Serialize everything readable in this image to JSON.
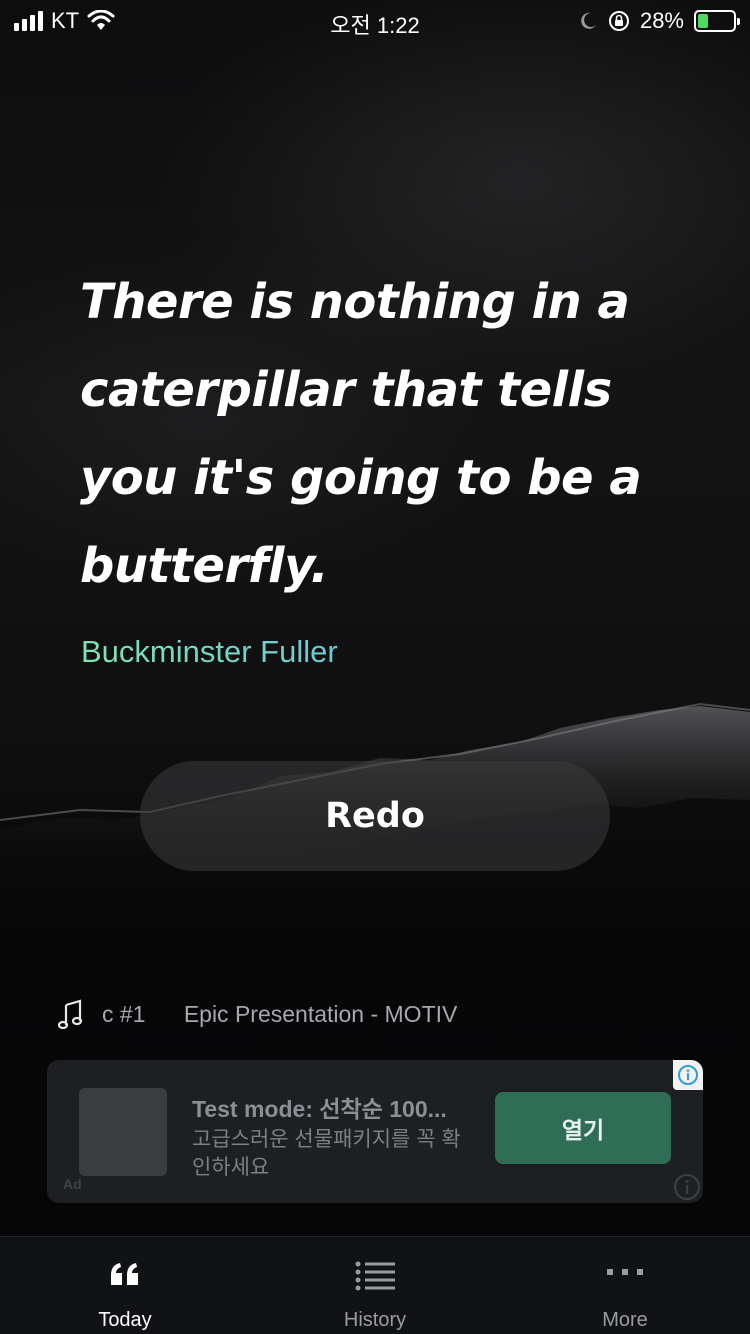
{
  "status_bar": {
    "carrier": "KT",
    "time": "오전 1:22",
    "battery_percent": "28%",
    "battery_level": 0.28
  },
  "quote": {
    "text": "There is nothing in a caterpillar that tells you it's going to be a butterfly.",
    "author": "Buckminster Fuller"
  },
  "redo_label": "Redo",
  "music": {
    "track": "c #1      Epic Presentation - MOTIV"
  },
  "ad": {
    "title": "Test mode: 선착순 100...",
    "description": "고급스러운 선물패키지를 꼭 확인하세요",
    "open_label": "열기",
    "badge": "Ad"
  },
  "tabs": [
    {
      "label": "Today",
      "icon": "quote-icon",
      "active": true
    },
    {
      "label": "History",
      "icon": "list-icon",
      "active": false
    },
    {
      "label": "More",
      "icon": "more-icon",
      "active": false
    }
  ],
  "colors": {
    "author_gradient_start": "#7fe3b0",
    "author_gradient_end": "#6ec8d8",
    "ad_button": "#2f6d57",
    "battery_fill": "#4cd964"
  }
}
